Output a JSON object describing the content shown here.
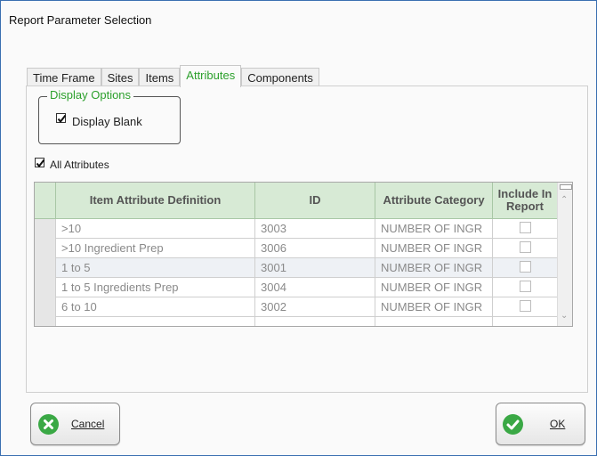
{
  "window": {
    "title": "Report Parameter Selection"
  },
  "tabs": [
    {
      "label": "Time Frame",
      "active": false
    },
    {
      "label": "Sites",
      "active": false
    },
    {
      "label": "Items",
      "active": false
    },
    {
      "label": "Attributes",
      "active": true
    },
    {
      "label": "Components",
      "active": false
    }
  ],
  "display_options": {
    "legend": "Display Options",
    "display_blank": {
      "label": "Display Blank",
      "checked": true
    }
  },
  "all_attributes": {
    "label": "All Attributes",
    "checked": true
  },
  "grid": {
    "columns": [
      "Item Attribute Definition",
      "ID",
      "Attribute Category",
      "Include In Report"
    ],
    "rows": [
      {
        "definition": ">10",
        "id": "3003",
        "category": "NUMBER OF INGR",
        "include": false
      },
      {
        "definition": ">10 Ingredient Prep",
        "id": "3006",
        "category": "NUMBER OF INGR",
        "include": false
      },
      {
        "definition": "1 to 5",
        "id": "3001",
        "category": "NUMBER OF INGR",
        "include": false
      },
      {
        "definition": "1 to 5 Ingredients Prep",
        "id": "3004",
        "category": "NUMBER OF INGR",
        "include": false
      },
      {
        "definition": "6 to 10",
        "id": "3002",
        "category": "NUMBER OF INGR",
        "include": false
      }
    ]
  },
  "buttons": {
    "cancel": {
      "label": "Cancel",
      "icon": "cancel-x-icon"
    },
    "ok": {
      "label": "OK",
      "icon": "checkmark-icon"
    }
  },
  "colors": {
    "accent_green": "#2ca02c",
    "header_green": "#d7ead5",
    "button_icon_green": "#3aa845"
  }
}
